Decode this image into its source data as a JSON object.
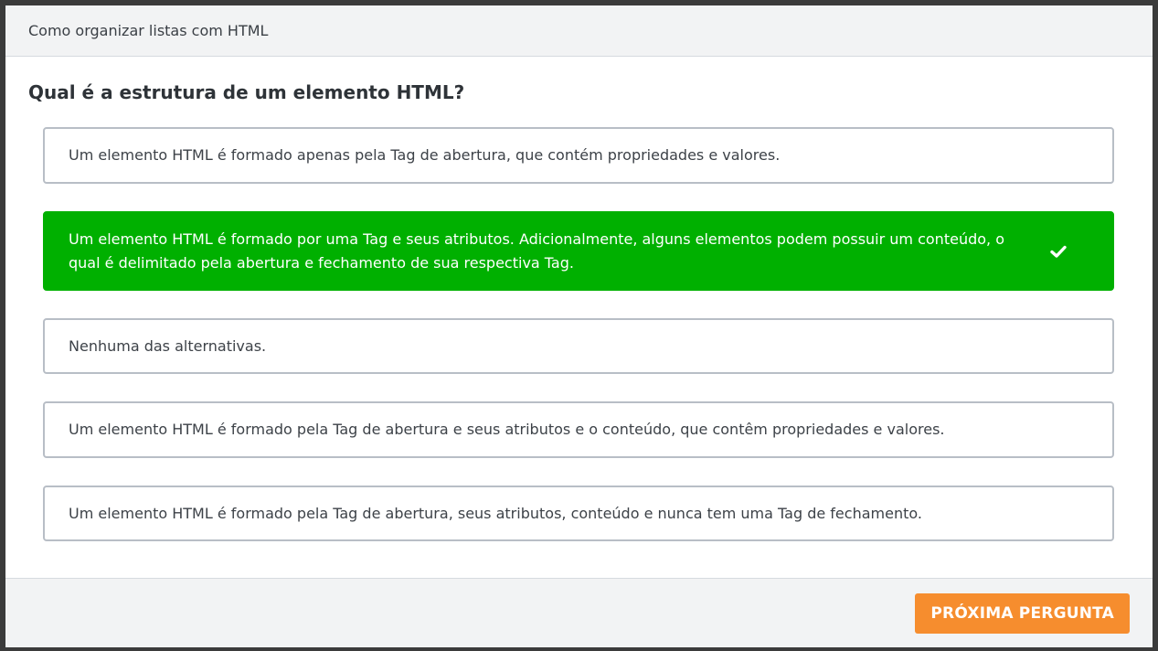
{
  "header": {
    "title": "Como organizar listas com HTML"
  },
  "question": {
    "text": "Qual é a estrutura de um elemento HTML?"
  },
  "options": [
    {
      "text": "Um elemento HTML é formado apenas pela Tag de abertura, que contém propriedades e valores.",
      "state": "default"
    },
    {
      "text": "Um elemento HTML é formado por uma Tag e seus atributos. Adicionalmente, alguns elementos podem possuir um conteúdo, o qual é delimitado pela abertura e fechamento de sua respectiva Tag.",
      "state": "correct"
    },
    {
      "text": "Nenhuma das alternativas.",
      "state": "default"
    },
    {
      "text": "Um elemento HTML é formado pela Tag de abertura e seus atributos e o conteúdo, que contêm propriedades e valores.",
      "state": "default"
    },
    {
      "text": "Um elemento HTML é formado pela Tag de abertura, seus atributos, conteúdo e nunca tem uma Tag de fechamento.",
      "state": "default"
    }
  ],
  "icons": {
    "correct": "check-icon"
  },
  "colors": {
    "correct": "#00b000",
    "accent_button": "#f68d2e",
    "option_border": "#b8bec6"
  },
  "footer": {
    "next_label": "PRÓXIMA PERGUNTA"
  }
}
